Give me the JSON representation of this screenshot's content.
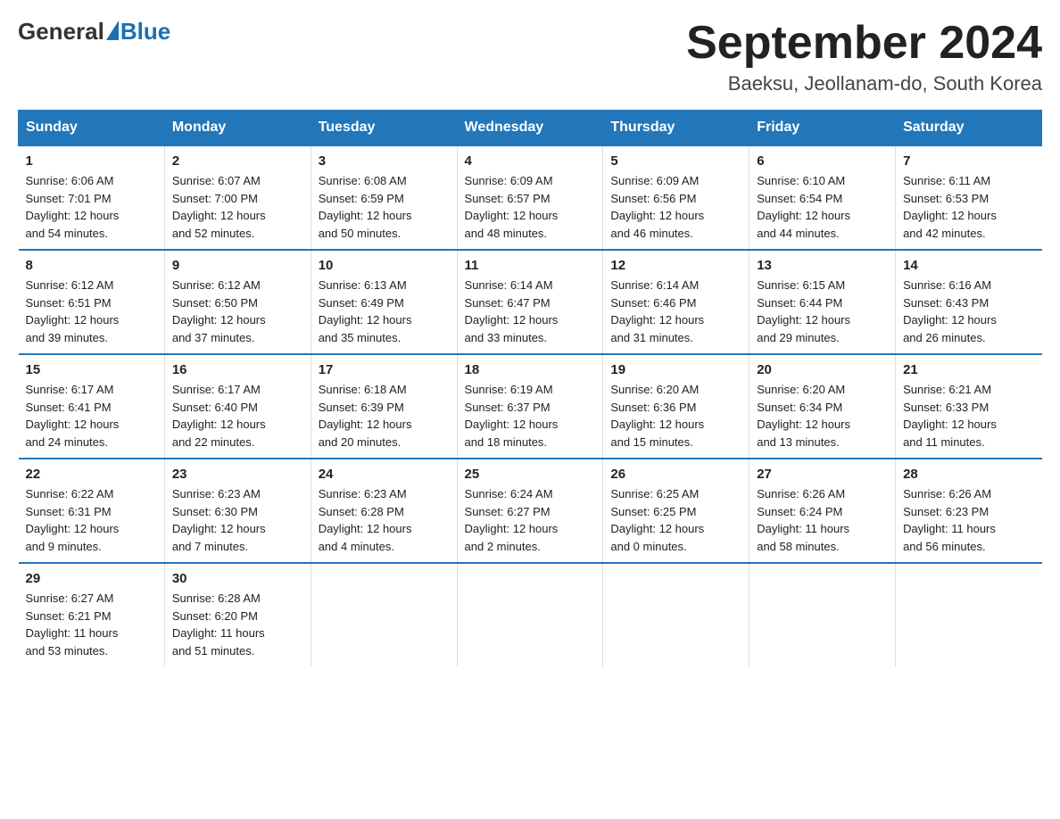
{
  "header": {
    "logo_general": "General",
    "logo_blue": "Blue",
    "month_title": "September 2024",
    "location": "Baeksu, Jeollanam-do, South Korea"
  },
  "weekdays": [
    "Sunday",
    "Monday",
    "Tuesday",
    "Wednesday",
    "Thursday",
    "Friday",
    "Saturday"
  ],
  "weeks": [
    [
      {
        "day": "1",
        "sunrise": "6:06 AM",
        "sunset": "7:01 PM",
        "daylight": "12 hours and 54 minutes."
      },
      {
        "day": "2",
        "sunrise": "6:07 AM",
        "sunset": "7:00 PM",
        "daylight": "12 hours and 52 minutes."
      },
      {
        "day": "3",
        "sunrise": "6:08 AM",
        "sunset": "6:59 PM",
        "daylight": "12 hours and 50 minutes."
      },
      {
        "day": "4",
        "sunrise": "6:09 AM",
        "sunset": "6:57 PM",
        "daylight": "12 hours and 48 minutes."
      },
      {
        "day": "5",
        "sunrise": "6:09 AM",
        "sunset": "6:56 PM",
        "daylight": "12 hours and 46 minutes."
      },
      {
        "day": "6",
        "sunrise": "6:10 AM",
        "sunset": "6:54 PM",
        "daylight": "12 hours and 44 minutes."
      },
      {
        "day": "7",
        "sunrise": "6:11 AM",
        "sunset": "6:53 PM",
        "daylight": "12 hours and 42 minutes."
      }
    ],
    [
      {
        "day": "8",
        "sunrise": "6:12 AM",
        "sunset": "6:51 PM",
        "daylight": "12 hours and 39 minutes."
      },
      {
        "day": "9",
        "sunrise": "6:12 AM",
        "sunset": "6:50 PM",
        "daylight": "12 hours and 37 minutes."
      },
      {
        "day": "10",
        "sunrise": "6:13 AM",
        "sunset": "6:49 PM",
        "daylight": "12 hours and 35 minutes."
      },
      {
        "day": "11",
        "sunrise": "6:14 AM",
        "sunset": "6:47 PM",
        "daylight": "12 hours and 33 minutes."
      },
      {
        "day": "12",
        "sunrise": "6:14 AM",
        "sunset": "6:46 PM",
        "daylight": "12 hours and 31 minutes."
      },
      {
        "day": "13",
        "sunrise": "6:15 AM",
        "sunset": "6:44 PM",
        "daylight": "12 hours and 29 minutes."
      },
      {
        "day": "14",
        "sunrise": "6:16 AM",
        "sunset": "6:43 PM",
        "daylight": "12 hours and 26 minutes."
      }
    ],
    [
      {
        "day": "15",
        "sunrise": "6:17 AM",
        "sunset": "6:41 PM",
        "daylight": "12 hours and 24 minutes."
      },
      {
        "day": "16",
        "sunrise": "6:17 AM",
        "sunset": "6:40 PM",
        "daylight": "12 hours and 22 minutes."
      },
      {
        "day": "17",
        "sunrise": "6:18 AM",
        "sunset": "6:39 PM",
        "daylight": "12 hours and 20 minutes."
      },
      {
        "day": "18",
        "sunrise": "6:19 AM",
        "sunset": "6:37 PM",
        "daylight": "12 hours and 18 minutes."
      },
      {
        "day": "19",
        "sunrise": "6:20 AM",
        "sunset": "6:36 PM",
        "daylight": "12 hours and 15 minutes."
      },
      {
        "day": "20",
        "sunrise": "6:20 AM",
        "sunset": "6:34 PM",
        "daylight": "12 hours and 13 minutes."
      },
      {
        "day": "21",
        "sunrise": "6:21 AM",
        "sunset": "6:33 PM",
        "daylight": "12 hours and 11 minutes."
      }
    ],
    [
      {
        "day": "22",
        "sunrise": "6:22 AM",
        "sunset": "6:31 PM",
        "daylight": "12 hours and 9 minutes."
      },
      {
        "day": "23",
        "sunrise": "6:23 AM",
        "sunset": "6:30 PM",
        "daylight": "12 hours and 7 minutes."
      },
      {
        "day": "24",
        "sunrise": "6:23 AM",
        "sunset": "6:28 PM",
        "daylight": "12 hours and 4 minutes."
      },
      {
        "day": "25",
        "sunrise": "6:24 AM",
        "sunset": "6:27 PM",
        "daylight": "12 hours and 2 minutes."
      },
      {
        "day": "26",
        "sunrise": "6:25 AM",
        "sunset": "6:25 PM",
        "daylight": "12 hours and 0 minutes."
      },
      {
        "day": "27",
        "sunrise": "6:26 AM",
        "sunset": "6:24 PM",
        "daylight": "11 hours and 58 minutes."
      },
      {
        "day": "28",
        "sunrise": "6:26 AM",
        "sunset": "6:23 PM",
        "daylight": "11 hours and 56 minutes."
      }
    ],
    [
      {
        "day": "29",
        "sunrise": "6:27 AM",
        "sunset": "6:21 PM",
        "daylight": "11 hours and 53 minutes."
      },
      {
        "day": "30",
        "sunrise": "6:28 AM",
        "sunset": "6:20 PM",
        "daylight": "11 hours and 51 minutes."
      },
      null,
      null,
      null,
      null,
      null
    ]
  ],
  "labels": {
    "sunrise": "Sunrise:",
    "sunset": "Sunset:",
    "daylight": "Daylight:"
  }
}
